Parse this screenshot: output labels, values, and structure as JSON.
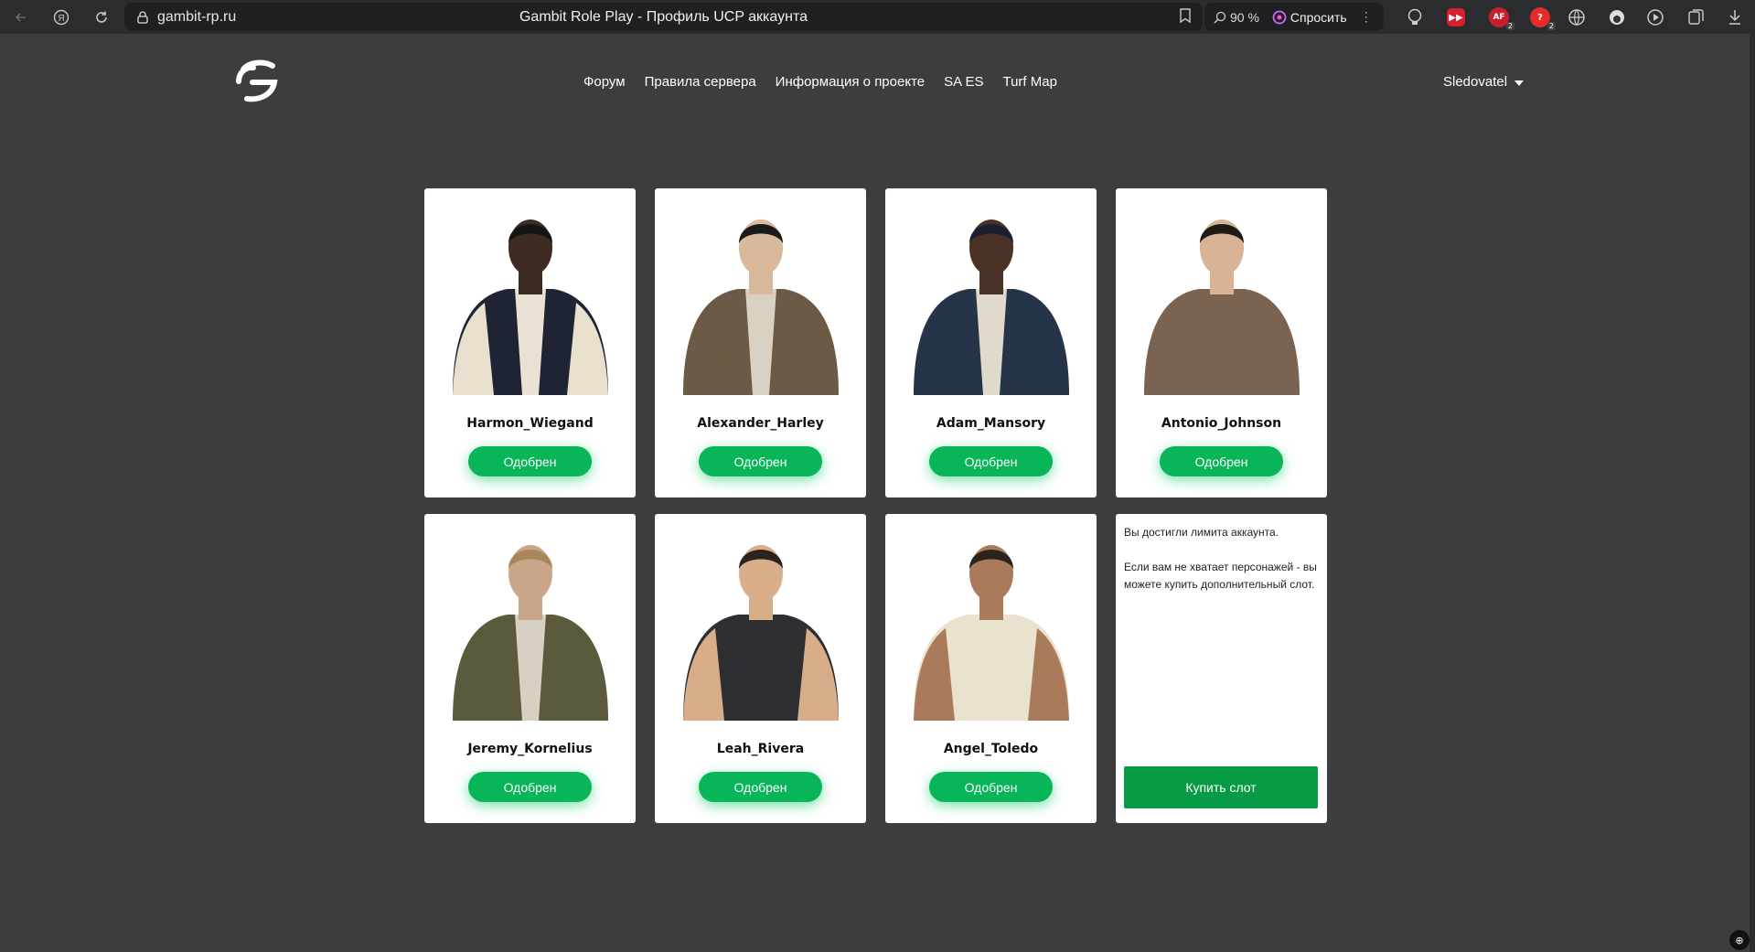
{
  "browser": {
    "url": "gambit-rp.ru",
    "tab_title": "Gambit Role Play - Профиль UCP аккаунта",
    "zoom": "90 %",
    "ask_label": "Спросить",
    "ext_af_label": "AF",
    "ext_af_count": "2",
    "ext_red_count": "2"
  },
  "site": {
    "nav": [
      {
        "label": "Форум"
      },
      {
        "label": "Правила сервера"
      },
      {
        "label": "Информация о проекте"
      },
      {
        "label": "SA ES"
      },
      {
        "label": "Turf Map"
      }
    ],
    "username": "Sledovatel"
  },
  "characters": [
    {
      "name": "Harmon_Wiegand",
      "status": "Одобрен",
      "skin": "#3e2b22",
      "jacket": "#1f2435",
      "shirt": "#e9e2d4",
      "sleeves": "#e8dfcc",
      "hair": "#151515"
    },
    {
      "name": "Alexander_Harley",
      "status": "Одобрен",
      "skin": "#d9b99b",
      "jacket": "#6b5a45",
      "shirt": "#d9d2c4",
      "sleeves": "#6b5a45",
      "hair": "#1a1a1a"
    },
    {
      "name": "Adam_Mansory",
      "status": "Одобрен",
      "skin": "#4a3326",
      "jacket": "#26344a",
      "shirt": "#e0dacd",
      "sleeves": "#26344a",
      "hair": "#1b2030"
    },
    {
      "name": "Antonio_Johnson",
      "status": "Одобрен",
      "skin": "#d8b494",
      "jacket": "#7a6350",
      "shirt": "#7a6350",
      "sleeves": "#7a6350",
      "hair": "#1e1a16"
    },
    {
      "name": "Jeremy_Kornelius",
      "status": "Одобрен",
      "skin": "#c9a58a",
      "jacket": "#5b5a3c",
      "shirt": "#d8d0c2",
      "sleeves": "#5b5a3c",
      "hair": "#a8875a"
    },
    {
      "name": "Leah_Rivera",
      "status": "Одобрен",
      "skin": "#d8ae8a",
      "jacket": "#2f2f33",
      "shirt": "#2f2f33",
      "sleeves": "#d8ae8a",
      "hair": "#2a2420"
    },
    {
      "name": "Angel_Toledo",
      "status": "Одобрен",
      "skin": "#a97b5b",
      "jacket": "#e8e2cf",
      "shirt": "#e8e2cf",
      "sleeves": "#a97b5b",
      "hair": "#2a241f"
    }
  ],
  "limit": {
    "line1": "Вы достигли лимита аккаунта.",
    "line2": "Если вам не хватает персонажей - вы можете купить дополнительный слот.",
    "buy_label": "Купить слот"
  }
}
